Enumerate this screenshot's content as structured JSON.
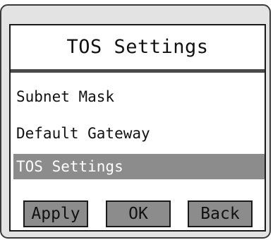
{
  "screen": {
    "title": "TOS Settings"
  },
  "menu": {
    "items": [
      {
        "label": "Subnet Mask"
      },
      {
        "label": "Default Gateway"
      },
      {
        "label": "TOS Settings"
      }
    ]
  },
  "buttons": {
    "apply_label": "Apply",
    "ok_label": "OK",
    "back_label": "Back"
  },
  "colors": {
    "device_background": "#e3e3e3",
    "selection_highlight": "#8c8c8c",
    "button_fill": "#8c8c8c",
    "text": "#111111"
  }
}
